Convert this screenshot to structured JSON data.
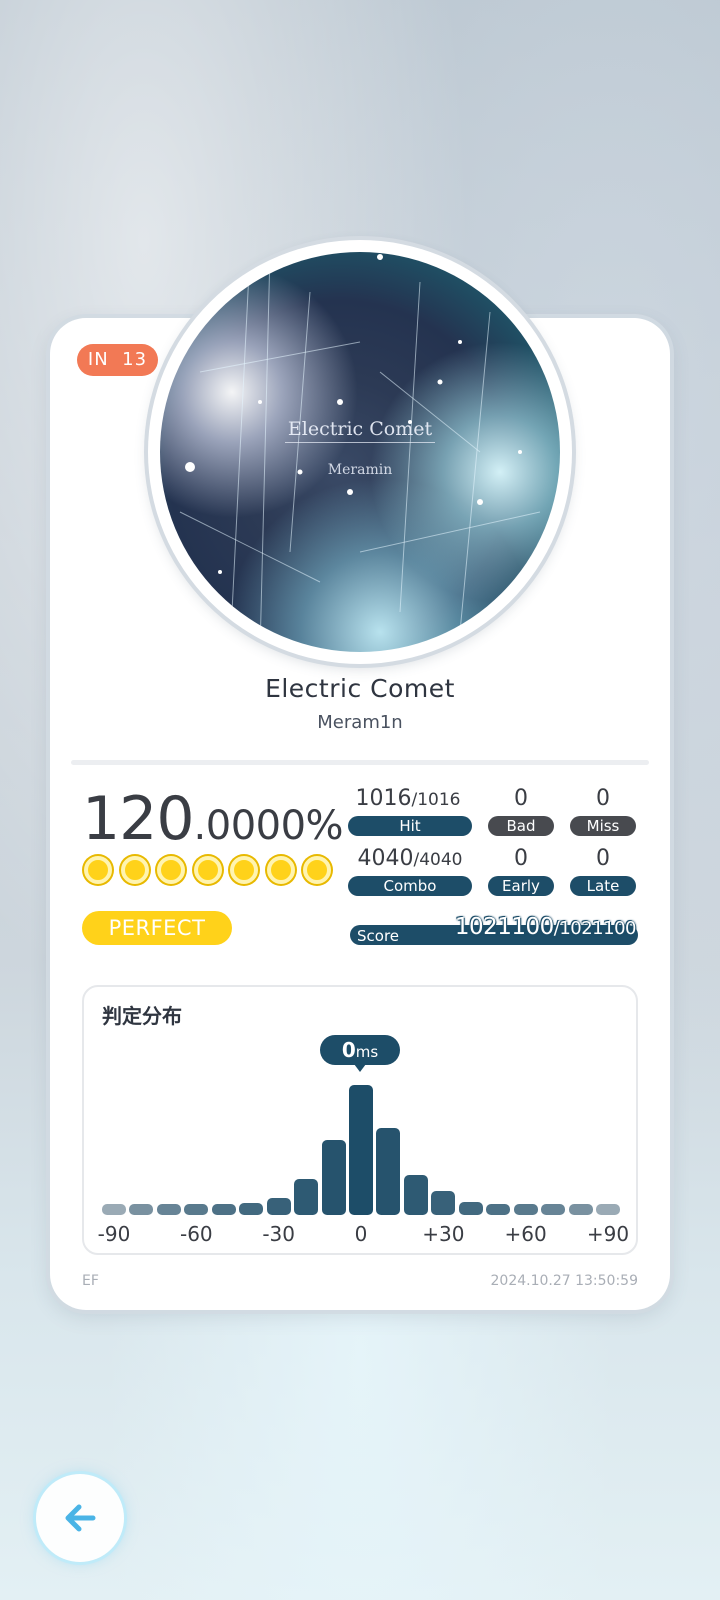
{
  "level_badge": {
    "difficulty": "IN",
    "level": "13"
  },
  "cover": {
    "title": "Electric Comet",
    "artist": "Meramin"
  },
  "song": {
    "title": "Electric Comet",
    "artist": "Meram1n"
  },
  "accuracy": {
    "integer": "120",
    "decimal": ".0000%"
  },
  "grade": "PERFECT",
  "grade_dots": 7,
  "stats": {
    "hit": {
      "value": "1016",
      "total": "/1016",
      "label": "Hit"
    },
    "bad": {
      "value": "0",
      "label": "Bad"
    },
    "miss": {
      "value": "0",
      "label": "Miss"
    },
    "combo": {
      "value": "4040",
      "total": "/4040",
      "label": "Combo"
    },
    "early": {
      "value": "0",
      "label": "Early"
    },
    "late": {
      "value": "0",
      "label": "Late"
    },
    "score": {
      "label": "Score",
      "value": "1021100",
      "total": "/1021100"
    }
  },
  "distribution": {
    "title": "判定分布",
    "bubble_value": "0",
    "bubble_unit": "ms"
  },
  "chart_data": {
    "type": "bar",
    "x_ticks": [
      "-90",
      "-60",
      "-30",
      "0",
      "+30",
      "+60",
      "+90"
    ],
    "values": [
      1,
      1,
      1,
      1,
      1,
      1.2,
      1.7,
      3.6,
      7.5,
      13,
      8.7,
      4,
      2.4,
      1.3,
      1.1,
      1,
      1,
      1,
      1
    ],
    "ylim": [
      0,
      13
    ]
  },
  "footer": {
    "left": "EF",
    "right": "2024.10.27 13:50:59"
  },
  "colors": {
    "accent": "#1d4d68",
    "badge": "#f27955",
    "gold": "#ffd21a",
    "bar_light": "#9aaab5"
  },
  "icons": {
    "back": "back-arrow-icon"
  }
}
